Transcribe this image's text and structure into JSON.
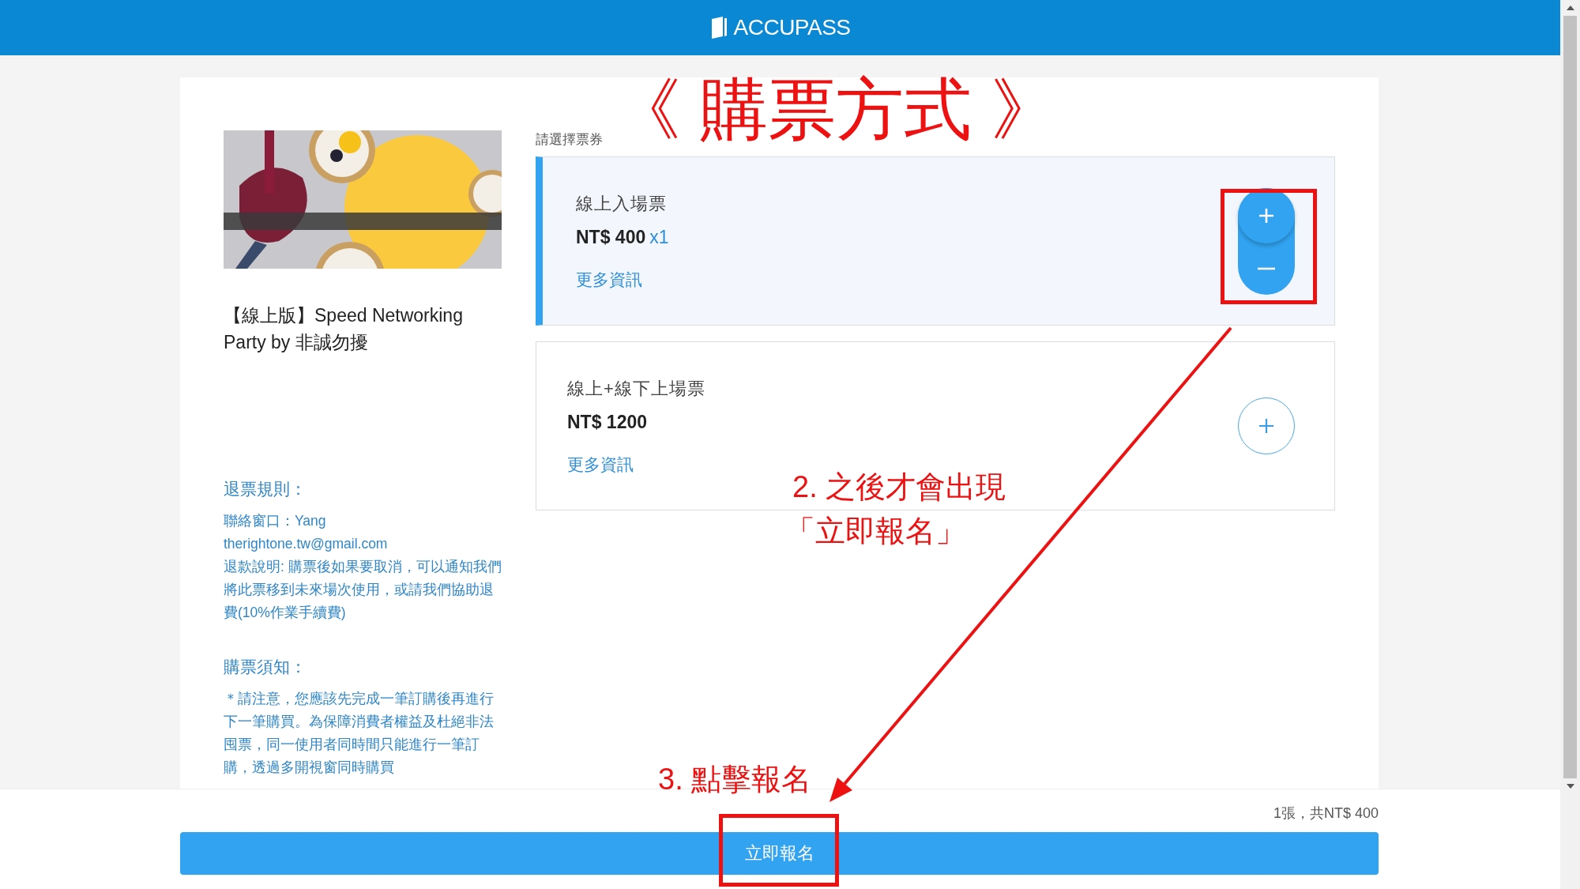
{
  "header": {
    "logo": "ACCUPASS"
  },
  "event": {
    "title": "【線上版】Speed Networking Party by 非誠勿擾"
  },
  "refund": {
    "heading": "退票規則：",
    "contact": "聯絡窗口：Yang",
    "email": "therightone.tw@gmail.com",
    "policy": "退款說明: 購票後如果要取消，可以通知我們將此票移到未來場次使用，或請我們協助退費(10%作業手續費)"
  },
  "notice": {
    "heading": "購票須知：",
    "text": "＊請注意，您應該先完成一筆訂購後再進行下一筆購買。為保障消費者權益及杜絕非法囤票，同一使用者同時間只能進行一筆訂購，透過多開視窗同時購買"
  },
  "tickets_label": "請選擇票券",
  "tickets": [
    {
      "name": "線上入場票",
      "price": "NT$ 400",
      "quantity": "x1",
      "link": "更多資訊",
      "selected": true
    },
    {
      "name": "線上+線下上場票",
      "price": "NT$ 1200",
      "link": "更多資訊",
      "selected": false
    }
  ],
  "footer": {
    "total": "1張，共NT$ 400",
    "button": "立即報名"
  },
  "annotations": {
    "title": "《 購票方式 》",
    "notes": [
      "2. 之後才會出現",
      "「立即報名」",
      "3. 點擊報名"
    ]
  }
}
